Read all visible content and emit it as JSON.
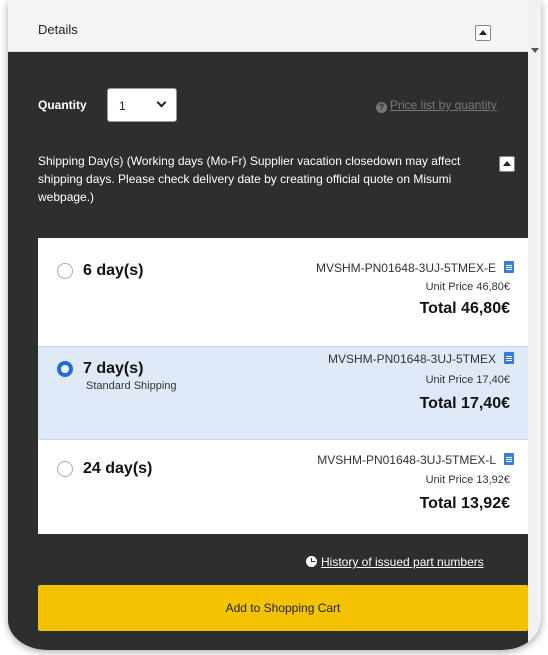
{
  "details": {
    "title": "Details"
  },
  "quantity": {
    "label": "Quantity",
    "value": "1"
  },
  "price_list": {
    "label": "Price list by quantity",
    "icon": "question-icon"
  },
  "shipping": {
    "heading": "Shipping Day(s) (Working days (Mo-Fr) Supplier vacation closedown may affect shipping days. Please check delivery date by creating official quote on Misumi webpage.)"
  },
  "options": [
    {
      "days": "6 day(s)",
      "sub": "",
      "part_no": "MVSHM-PN01648-3UJ-5TMEX-E",
      "unit_price": "Unit Price 46,80€",
      "total": "Total 46,80€",
      "selected": false
    },
    {
      "days": "7 day(s)",
      "sub": "Standard Shipping",
      "part_no": "MVSHM-PN01648-3UJ-5TMEX",
      "unit_price": "Unit Price 17,40€",
      "total": "Total 17,40€",
      "selected": true
    },
    {
      "days": "24 day(s)",
      "sub": "",
      "part_no": "MVSHM-PN01648-3UJ-5TMEX-L",
      "unit_price": "Unit Price 13,92€",
      "total": "Total 13,92€",
      "selected": false
    }
  ],
  "history": {
    "label": "History of issued part numbers",
    "icon": "clock-icon"
  },
  "cart": {
    "label": "Add to Shopping Cart"
  },
  "colors": {
    "panel_bg": "#2e2e2e",
    "accent_blue": "#1e6ed8",
    "cart_yellow": "#f3c200",
    "selected_bg": "#dfe9f7"
  }
}
